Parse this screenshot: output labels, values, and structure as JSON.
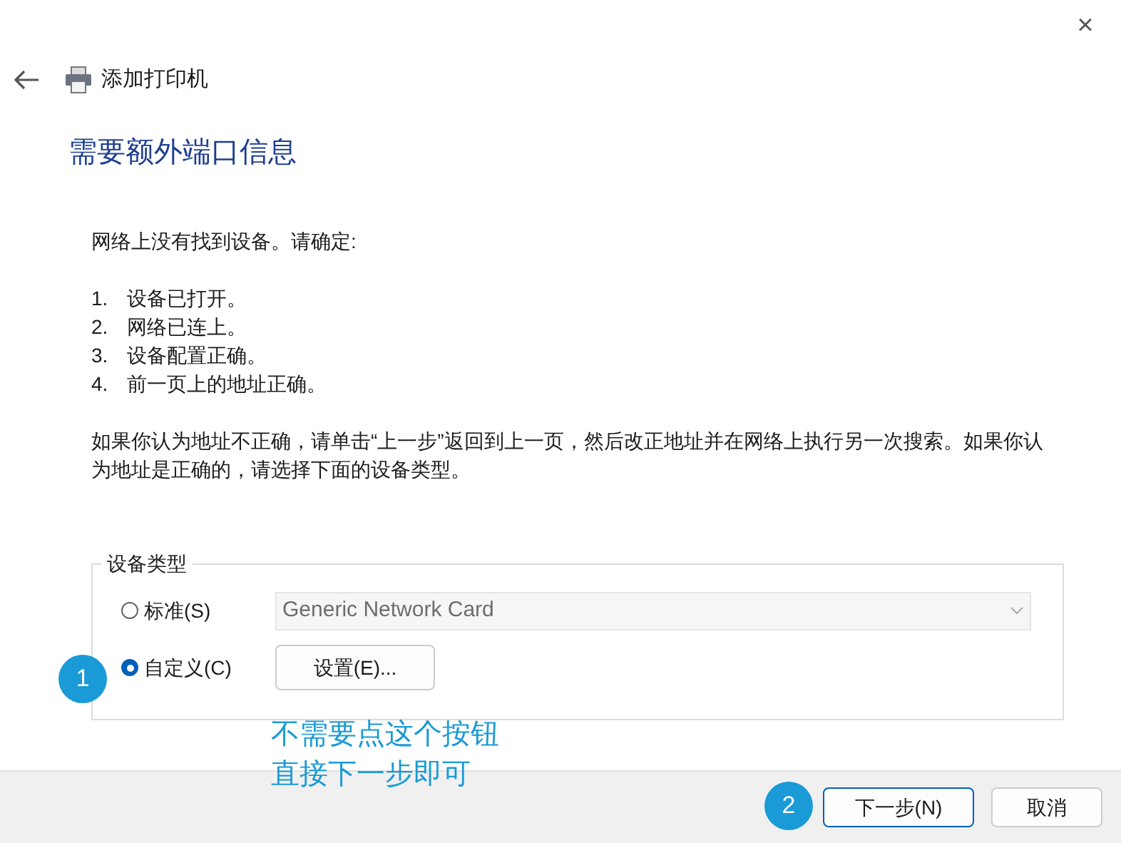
{
  "window": {
    "title": "添加打印机",
    "close": "×"
  },
  "heading": "需要额外端口信息",
  "intro": "网络上没有找到设备。请确定:",
  "checklist": [
    {
      "number": "1.",
      "text": "设备已打开。"
    },
    {
      "number": "2.",
      "text": "网络已连上。"
    },
    {
      "number": "3.",
      "text": "设备配置正确。"
    },
    {
      "number": "4.",
      "text": "前一页上的地址正确。"
    }
  ],
  "advice": "如果你认为地址不正确，请单击“上一步”返回到上一页，然后改正地址并在网络上执行另一次搜索。如果你认为地址是正确的，请选择下面的设备类型。",
  "device_type": {
    "legend": "设备类型",
    "options": [
      {
        "label": "标准(S)",
        "selected": false,
        "kind": "dropdown",
        "value": "Generic Network Card",
        "disabled": true
      },
      {
        "label": "自定义(C)",
        "selected": true,
        "kind": "button",
        "button": "设置(E)..."
      }
    ]
  },
  "annotations": [
    {
      "number": "1"
    },
    {
      "number": "2"
    }
  ],
  "note": [
    "不需要点这个按钮",
    "直接下一步即可"
  ],
  "buttons": [
    {
      "label": "下一步(N)",
      "default": true
    },
    {
      "label": "取消",
      "default": false
    }
  ]
}
